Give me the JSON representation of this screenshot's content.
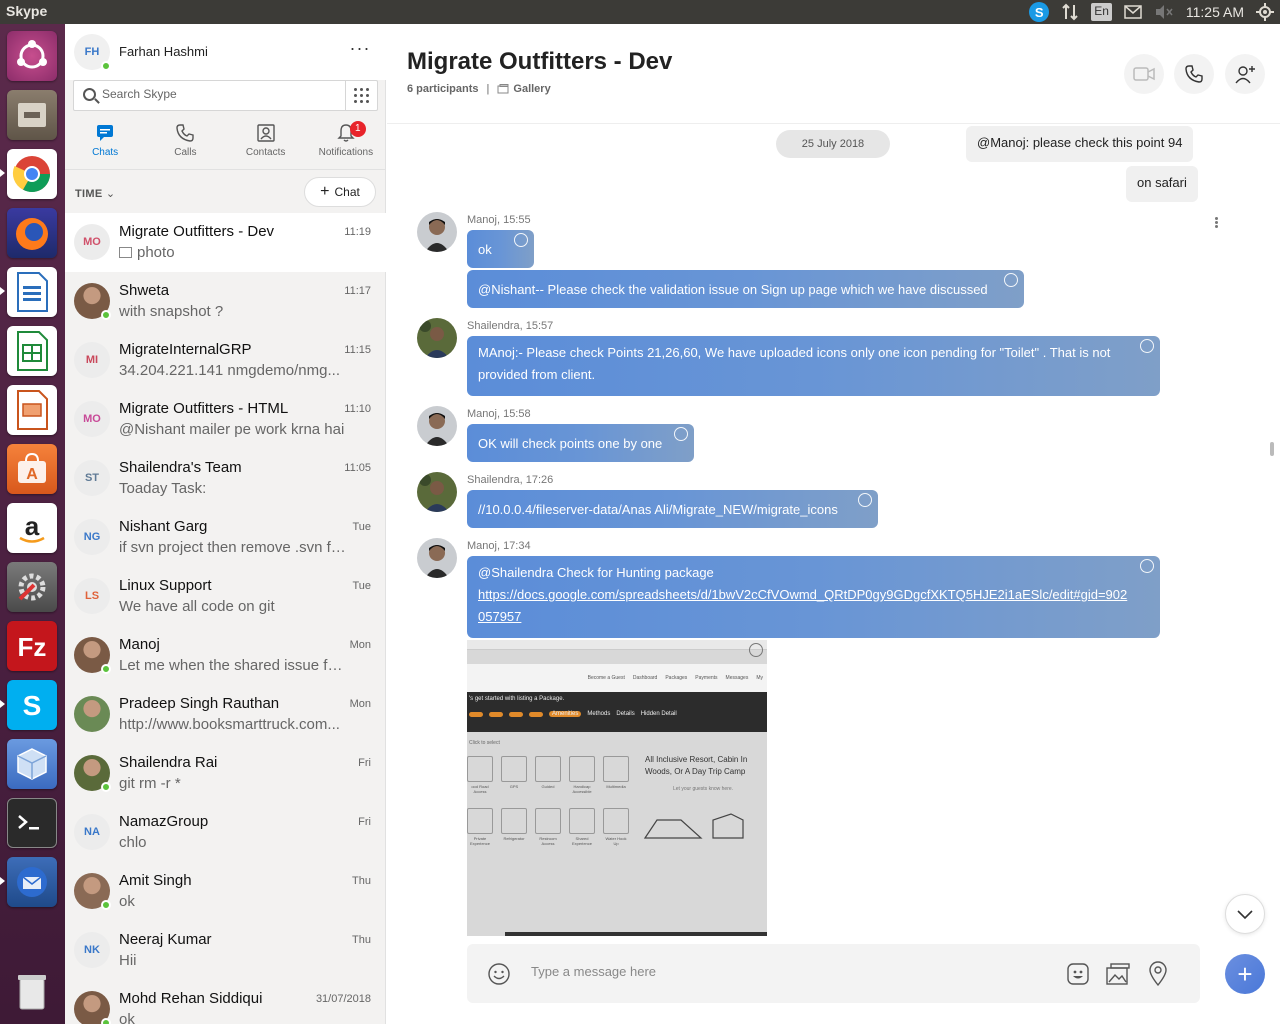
{
  "topbar": {
    "app_title": "Skype",
    "lang": "En",
    "time": "11:25 AM"
  },
  "profile": {
    "initials": "FH",
    "name": "Farhan Hashmi",
    "more": "···"
  },
  "search": {
    "placeholder": "Search Skype"
  },
  "tabs": [
    {
      "label": "Chats"
    },
    {
      "label": "Calls"
    },
    {
      "label": "Contacts"
    },
    {
      "label": "Notifications",
      "badge": "1"
    }
  ],
  "sort_label": "TIME",
  "new_chat_label": "Chat",
  "chats": [
    {
      "initials": "MO",
      "name": "Migrate Outfitters - Dev",
      "preview": "photo",
      "time": "11:19",
      "selected": true,
      "avatar_color": "#d0506a"
    },
    {
      "initials": "",
      "name": "Shweta",
      "preview": "with snapshot ?",
      "time": "11:17",
      "online": true
    },
    {
      "initials": "MI",
      "name": "MigrateInternalGRP",
      "preview": "34.204.221.141 nmgdemo/nmg...",
      "time": "11:15",
      "avatar_color": "#c9485b"
    },
    {
      "initials": "MO",
      "name": "Migrate Outfitters - HTML",
      "preview": "@Nishant mailer pe work krna hai",
      "time": "11:10",
      "avatar_color": "#c84a98"
    },
    {
      "initials": "ST",
      "name": "Shailendra's Team",
      "preview": "Toaday Task:",
      "time": "11:05",
      "avatar_color": "#5f7a95"
    },
    {
      "initials": "NG",
      "name": "Nishant Garg",
      "preview": "if svn project then remove .svn fol...",
      "time": "Tue",
      "avatar_color": "#3a78c9"
    },
    {
      "initials": "LS",
      "name": "Linux Support",
      "preview": "We have all code on git",
      "time": "Tue",
      "avatar_color": "#e0623a"
    },
    {
      "initials": "",
      "name": "Manoj",
      "preview": "Let me when the shared issue for...",
      "time": "Mon",
      "online": true
    },
    {
      "initials": "",
      "name": "Pradeep Singh Rauthan",
      "preview": "http://www.booksmarttruck.com...",
      "time": "Mon"
    },
    {
      "initials": "",
      "name": "Shailendra Rai",
      "preview": "git rm -r *",
      "time": "Fri",
      "online": true
    },
    {
      "initials": "NA",
      "name": "NamazGroup",
      "preview": "chlo",
      "time": "Fri",
      "avatar_color": "#3a78c9"
    },
    {
      "initials": "",
      "name": "Amit Singh",
      "preview": "ok",
      "time": "Thu",
      "online": true
    },
    {
      "initials": "NK",
      "name": "Neeraj Kumar",
      "preview": "Hii",
      "time": "Thu",
      "avatar_color": "#3a78c9"
    },
    {
      "initials": "",
      "name": "Mohd Rehan Siddiqui",
      "preview": "ok",
      "time": "31/07/2018",
      "online": true
    }
  ],
  "conversation": {
    "title": "Migrate Outfitters - Dev",
    "participants": "6 participants",
    "separator": "|",
    "gallery": "Gallery",
    "date": "25 July 2018",
    "outgoing": [
      "@Manoj: please check this point 94",
      "on safari"
    ],
    "messages": [
      {
        "meta": "Manoj, 15:55",
        "text": "ok"
      },
      {
        "text": "@Nishant-- Please check the validation issue on Sign up page which we have discussed"
      },
      {
        "meta": "Shailendra, 15:57",
        "text": "MAnoj:- Please check Points 21,26,60, We have uploaded icons only one icon pending for \"Toilet\" . That is not provided from client."
      },
      {
        "meta": "Manoj, 15:58",
        "text": "OK will check points one by one"
      },
      {
        "meta": "Shailendra, 17:26",
        "text": "//10.0.0.4/fileserver-data/Anas Ali/Migrate_NEW/migrate_icons"
      },
      {
        "meta": "Manoj, 17:34",
        "text": "@Shailendra Check for Hunting package",
        "link": "https://docs.google.com/spreadsheets/d/1bwV2cCfVOwmd_QRtDP0gy9GDgcfXKTQ5HJE2i1aESlc/edit#gid=902057957"
      }
    ],
    "attachment": {
      "nav_items": [
        "Become a Guest",
        "Dashboard",
        "Packages",
        "Payments",
        "Messages",
        "My"
      ],
      "headline": "'s get started with listing a Package.",
      "steps": [
        "Amenities",
        "Methods",
        "Details",
        "Hidden Detail"
      ],
      "hint": "Click to select",
      "amenities_row1": [
        "ood Road Access",
        "GPS",
        "Guided",
        "Handicap Accessible",
        "Multimedia"
      ],
      "amenities_row2": [
        "Private Experience",
        "Refrigerator",
        "Restroom Access",
        "Shared Experience",
        "Water Hook Up"
      ],
      "side_text": "All Inclusive Resort, Cabin In Woods, Or A Day Trip Camp",
      "side_link": "Let your guests know here."
    }
  },
  "composer": {
    "placeholder": "Type a message here"
  }
}
